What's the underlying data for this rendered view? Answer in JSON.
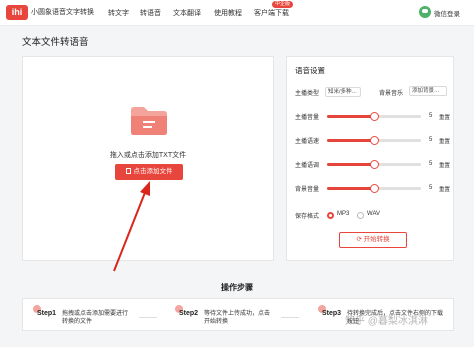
{
  "app": {
    "logo_text": "ihi",
    "brand": "小圆象语音文字转换"
  },
  "nav": [
    {
      "label": "转文字"
    },
    {
      "label": "转语音"
    },
    {
      "label": "文本翻译"
    },
    {
      "label": "使用教程"
    },
    {
      "label": "客户端下载",
      "badge": "中企版"
    }
  ],
  "user": {
    "login_label": "微信登录"
  },
  "page": {
    "title": "文本文件转语音"
  },
  "upload": {
    "hint": "拖入或点击添加TXT文件",
    "button_label": "点击添加文件"
  },
  "settings": {
    "title": "语音设置",
    "voice_label": "主播类型",
    "voice_value": "知米/多种…",
    "bgm_label": "背景音乐",
    "bgm_value": "添加背景…",
    "sliders": [
      {
        "label": "主播音量",
        "value": "5",
        "fraction": 0.5,
        "reset": "重置"
      },
      {
        "label": "主播语速",
        "value": "5",
        "fraction": 0.5,
        "reset": "重置"
      },
      {
        "label": "主播语调",
        "value": "5",
        "fraction": 0.5,
        "reset": "重置"
      },
      {
        "label": "背景音量",
        "value": "5",
        "fraction": 0.5,
        "reset": "重置"
      }
    ],
    "format_label": "保存格式",
    "formats": [
      {
        "label": "MP3",
        "selected": true
      },
      {
        "label": "WAV",
        "selected": false
      }
    ],
    "convert_label": "开始转换"
  },
  "steps": {
    "title": "操作步骤",
    "items": [
      {
        "name": "Step1",
        "text": "拖拽或点击添加需要进行转换的文件"
      },
      {
        "name": "Step2",
        "text": "等待文件上传成功，点击开始转换"
      },
      {
        "name": "Step3",
        "text": "待转换完成后，点击文件右侧的下载按钮"
      }
    ]
  },
  "watermark": "知乎 @暮梨冰淇淋",
  "colors": {
    "accent": "#e8453c",
    "background": "#f4f5f7"
  },
  "icons": {
    "folder": "folder-icon",
    "arrow": "red-arrow-annotation"
  }
}
